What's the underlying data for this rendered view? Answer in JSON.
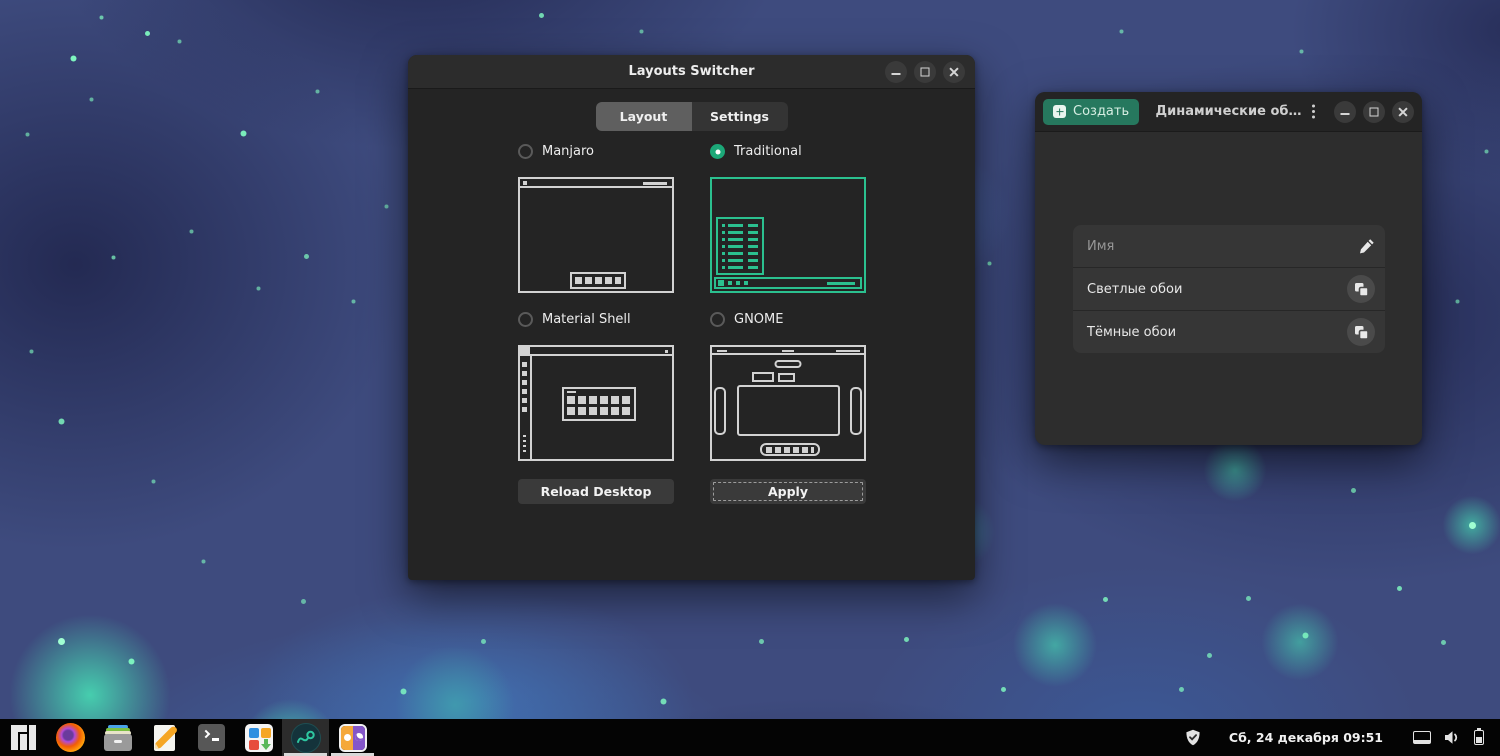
{
  "layouts_window": {
    "title": "Layouts Switcher",
    "tabs": [
      {
        "label": "Layout",
        "selected": true
      },
      {
        "label": "Settings",
        "selected": false
      }
    ],
    "options": [
      {
        "label": "Manjaro",
        "selected": false
      },
      {
        "label": "Traditional",
        "selected": true
      },
      {
        "label": "Material Shell",
        "selected": false
      },
      {
        "label": "GNOME",
        "selected": false
      }
    ],
    "reload_button": "Reload Desktop",
    "apply_button": "Apply"
  },
  "wallpaper_window": {
    "create_button": "Создать",
    "title": "Динамические об…",
    "rows": [
      {
        "label": "Имя",
        "icon": "pencil-icon",
        "placeholder": true
      },
      {
        "label": "Светлые обои",
        "icon": "insert-image-icon"
      },
      {
        "label": "Тёмные обои",
        "icon": "insert-image-icon"
      }
    ]
  },
  "taskbar": {
    "apps": [
      "manjaro-menu",
      "firefox",
      "file-manager",
      "text-editor",
      "terminal",
      "software-center",
      "layouts-switcher",
      "dynamic-wallpapers"
    ],
    "focused_app": "layouts-switcher",
    "running_apps": [
      "layouts-switcher",
      "dynamic-wallpapers"
    ],
    "clock": "Сб, 24 декабря 09:51",
    "tray_icons": [
      "shield-check-icon",
      "display-icon",
      "volume-icon",
      "battery-icon"
    ]
  },
  "colors": {
    "accent_teal": "#2bc08f",
    "radio_selected": "#1ca878",
    "create_button_green": "#26785e",
    "window_bg": "#242424",
    "titlebar_bg": "#2c2c2c",
    "taskbar_bg": "#040404"
  }
}
